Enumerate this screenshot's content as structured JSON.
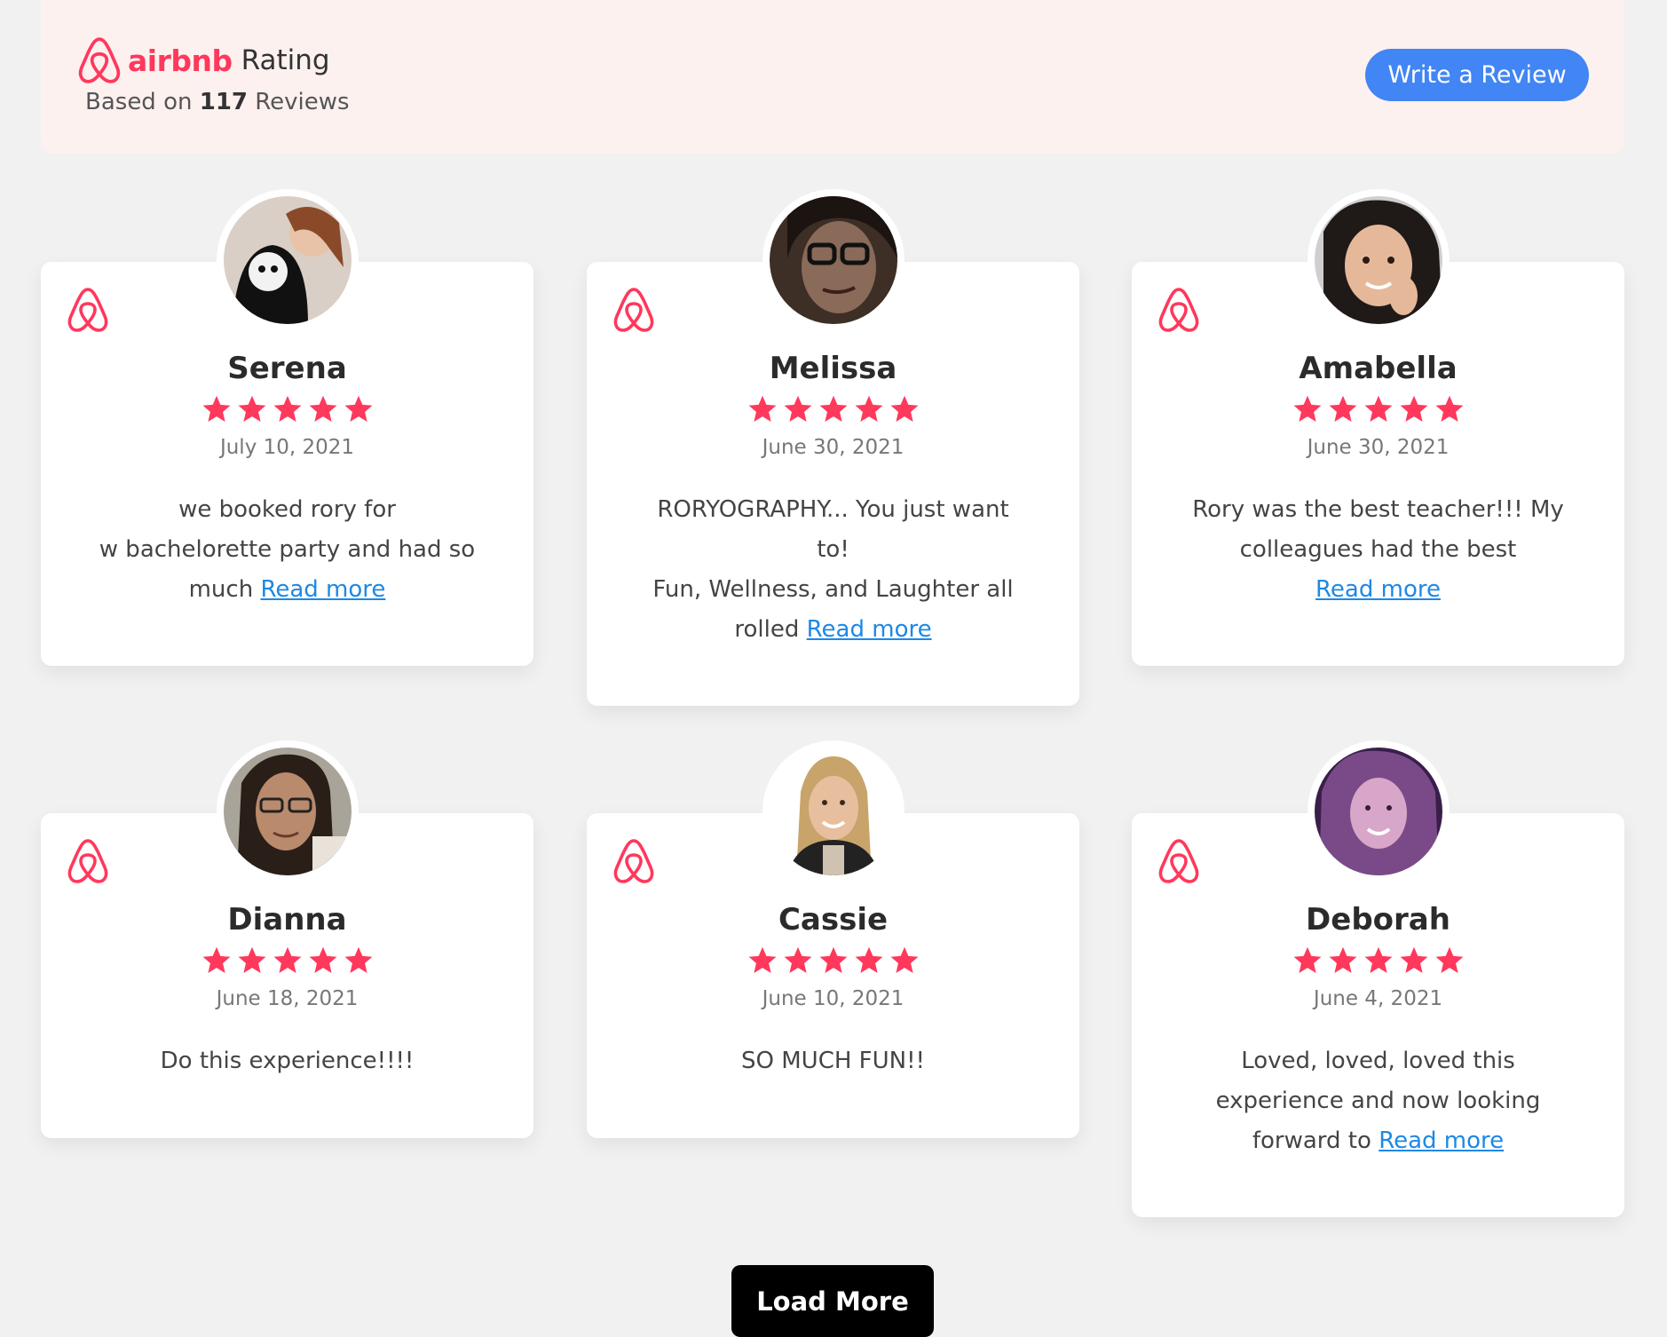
{
  "header": {
    "brand": "airbnb",
    "rating_label": "Rating",
    "based_on_prefix": "Based on",
    "review_count": "117",
    "reviews_suffix": "Reviews",
    "write_review_label": "Write a Review"
  },
  "colors": {
    "brand": "#ff385c",
    "star": "#ff385c",
    "button_blue": "#4285f4",
    "link": "#1e88e5",
    "header_bg": "#fdf1f0"
  },
  "icons": {
    "logo": "airbnb-logo-icon",
    "star": "star-icon"
  },
  "reviews": [
    {
      "name": "Serena",
      "rating": 5,
      "date": "July 10, 2021",
      "text_lines": [
        "we booked rory for",
        "w bachelorette party and had so",
        "much "
      ],
      "read_more": "Read more"
    },
    {
      "name": "Melissa",
      "rating": 5,
      "date": "June 30, 2021",
      "text_lines": [
        "RORYOGRAPHY... You just want",
        "to!",
        "Fun, Wellness, and Laughter all",
        "rolled "
      ],
      "read_more": "Read more"
    },
    {
      "name": "Amabella",
      "rating": 5,
      "date": "June 30, 2021",
      "text_lines": [
        "Rory was the best teacher!!! My",
        "colleagues had the best",
        ""
      ],
      "read_more": "Read more"
    },
    {
      "name": "Dianna",
      "rating": 5,
      "date": "June 18, 2021",
      "text_lines": [
        "Do this experience!!!!"
      ],
      "read_more": ""
    },
    {
      "name": "Cassie",
      "rating": 5,
      "date": "June 10, 2021",
      "text_lines": [
        "SO MUCH FUN!!"
      ],
      "read_more": ""
    },
    {
      "name": "Deborah",
      "rating": 5,
      "date": "June 4, 2021",
      "text_lines": [
        "Loved, loved, loved this",
        "experience and now looking",
        "forward to "
      ],
      "read_more": "Read more"
    }
  ],
  "load_more_label": "Load More"
}
